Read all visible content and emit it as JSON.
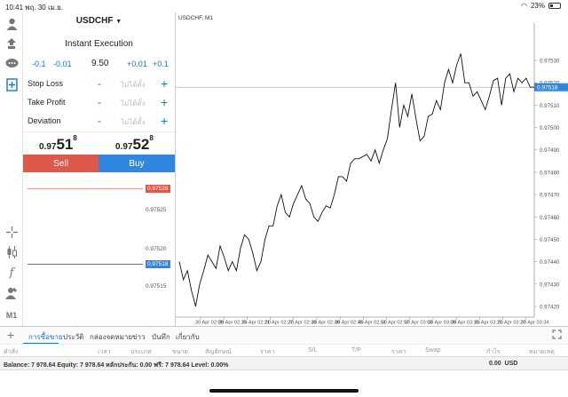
{
  "status_bar": {
    "time": "10:41",
    "date": "พฤ. 30 เม.ย.",
    "battery": "23%"
  },
  "left_toolbar": {
    "icons": [
      "account-icon",
      "signal-icon",
      "chat-icon",
      "new-order-icon"
    ],
    "bottom_icons": [
      "crosshair-icon",
      "candles-icon",
      "indicator-icon",
      "objects-icon"
    ],
    "timeframe": "M1"
  },
  "order": {
    "symbol": "USDCHF",
    "mode": "Instant Execution",
    "vol_minus_1": "-0.1",
    "vol_minus_2": "-0.01",
    "volume": "9.50",
    "vol_plus_1": "+0.01",
    "vol_plus_2": "+0.1",
    "stop_loss_label": "Stop Loss",
    "stop_loss_value": "ไม่ได้ตั้ง",
    "take_profit_label": "Take Profit",
    "take_profit_value": "ไม่ได้ตั้ง",
    "deviation_label": "Deviation",
    "deviation_value": "ไม่ได้ตั้ง",
    "sell_price": {
      "prefix": "0.97",
      "big": "51",
      "pip": "8"
    },
    "buy_price": {
      "prefix": "0.97",
      "big": "52",
      "pip": "8"
    },
    "sell_label": "Sell",
    "buy_label": "Buy",
    "mini_chart": {
      "labels": [
        "0.97525",
        "0.97520",
        "0.97515"
      ],
      "ask_tag": "0.97528",
      "bid_tag": "0.97518"
    }
  },
  "chart": {
    "title": "USDCHF, M1",
    "price_tag": "0.97518",
    "y_labels": [
      "0.97530",
      "0.97520",
      "0.97510",
      "0.97500",
      "0.97490",
      "0.97480",
      "0.97470",
      "0.97460",
      "0.97450",
      "0.97440",
      "0.97430",
      "0.97420"
    ],
    "x_labels": [
      "30 Apr 02:09",
      "30 Apr 02:15",
      "30 Apr 02:21",
      "30 Apr 02:27",
      "30 Apr 02:33",
      "30 Apr 02:39",
      "30 Apr 02:45",
      "30 Apr 02:51",
      "30 Apr 02:57",
      "30 Apr 03:03",
      "30 Apr 03:09",
      "30 Apr 03:15",
      "30 Apr 03:21",
      "30 Apr 03:27",
      "30 Apr 03:34"
    ]
  },
  "chart_data": {
    "type": "line",
    "title": "USDCHF, M1",
    "ylim": [
      0.97415,
      0.97535
    ],
    "values": [
      0.9744,
      0.97432,
      0.97436,
      0.97427,
      0.9742,
      0.9743,
      0.97436,
      0.97443,
      0.9744,
      0.97437,
      0.97447,
      0.97442,
      0.97436,
      0.9744,
      0.97436,
      0.97446,
      0.97452,
      0.9745,
      0.97444,
      0.97436,
      0.9744,
      0.9745,
      0.97456,
      0.97456,
      0.97465,
      0.9747,
      0.97462,
      0.9746,
      0.97466,
      0.9747,
      0.97474,
      0.97468,
      0.97466,
      0.9746,
      0.97458,
      0.97462,
      0.97465,
      0.97464,
      0.9747,
      0.97478,
      0.97478,
      0.97476,
      0.97484,
      0.97486,
      0.97486,
      0.97487,
      0.97488,
      0.97485,
      0.9749,
      0.97484,
      0.9749,
      0.97495,
      0.97508,
      0.9752,
      0.975,
      0.9751,
      0.97505,
      0.97515,
      0.97504,
      0.97494,
      0.97496,
      0.97505,
      0.97506,
      0.97512,
      0.97508,
      0.9752,
      0.97526,
      0.9752,
      0.97528,
      0.97533,
      0.9752,
      0.9752,
      0.97514,
      0.97516,
      0.97512,
      0.97508,
      0.97514,
      0.97521,
      0.97522,
      0.9751,
      0.97522,
      0.97524,
      0.97516,
      0.97522,
      0.9752,
      0.97522,
      0.97518,
      0.97518
    ]
  },
  "terminal_tabs": [
    "การซื้อขาย",
    "ประวัติ",
    "กล่องจดหมาย",
    "ข่าว",
    "บันทึก",
    "เกี่ยวกับ"
  ],
  "columns": [
    "คำสั่ง",
    "เวลา",
    "ประเภท",
    "ขนาด",
    "สัญลักษณ์",
    "ราคา",
    "S/L",
    "T/P",
    "ราคา",
    "Swap",
    "กำไร",
    "หมายเหตุ"
  ],
  "balance": {
    "text": "Balance: 7 978.64 Equity: 7 978.64 หลักประกัน: 0.00 ฟรี: 7 978.64 Level: 0.00%",
    "profit": "0.00",
    "currency": "USD"
  }
}
